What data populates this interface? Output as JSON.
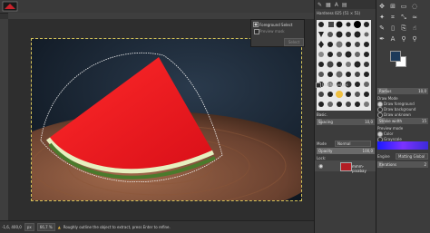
{
  "status": {
    "coords": "-1,6, 400,0",
    "unit": "px",
    "zoom": "66,7 %",
    "message": "Roughly outline the object to extract, press Enter to refine."
  },
  "dialog": {
    "title": "Foreground Select",
    "subtitle": "Preview mask",
    "select_label": "Select"
  },
  "brushes": {
    "header": "Hardness 025 (51 × 51)",
    "brush_name": "Basic.",
    "spacing_label": "Spacing",
    "spacing_value": "10,0"
  },
  "layers": {
    "mode_label": "Mode",
    "mode_value": "Normal",
    "opacity_label": "Opacity",
    "opacity_value": "100,0",
    "lock_label": "Lock:",
    "layer_name": "mmm-pixabay"
  },
  "tool_options": {
    "draw_mode_label": "Draw Mode",
    "draw_foreground": "Draw foreground",
    "draw_background": "Draw background",
    "draw_unknown": "Draw unknown",
    "stroke_width_label": "Stroke width",
    "stroke_width_value": "15",
    "preview_mode_label": "Preview mode",
    "color_label": "Color",
    "grayscale_label": "Grayscale",
    "engine_label": "Engine",
    "engine_value": "Matting Global",
    "iterations_label": "Iterations",
    "iterations_value": "2",
    "feather_label": "Feather edges",
    "radius_label": "Radius",
    "radius_value": "10,0"
  },
  "colors": {
    "foreground": "#1d3a5a",
    "background": "#ffffff",
    "accent_gradient_start": "#1a1aff"
  }
}
